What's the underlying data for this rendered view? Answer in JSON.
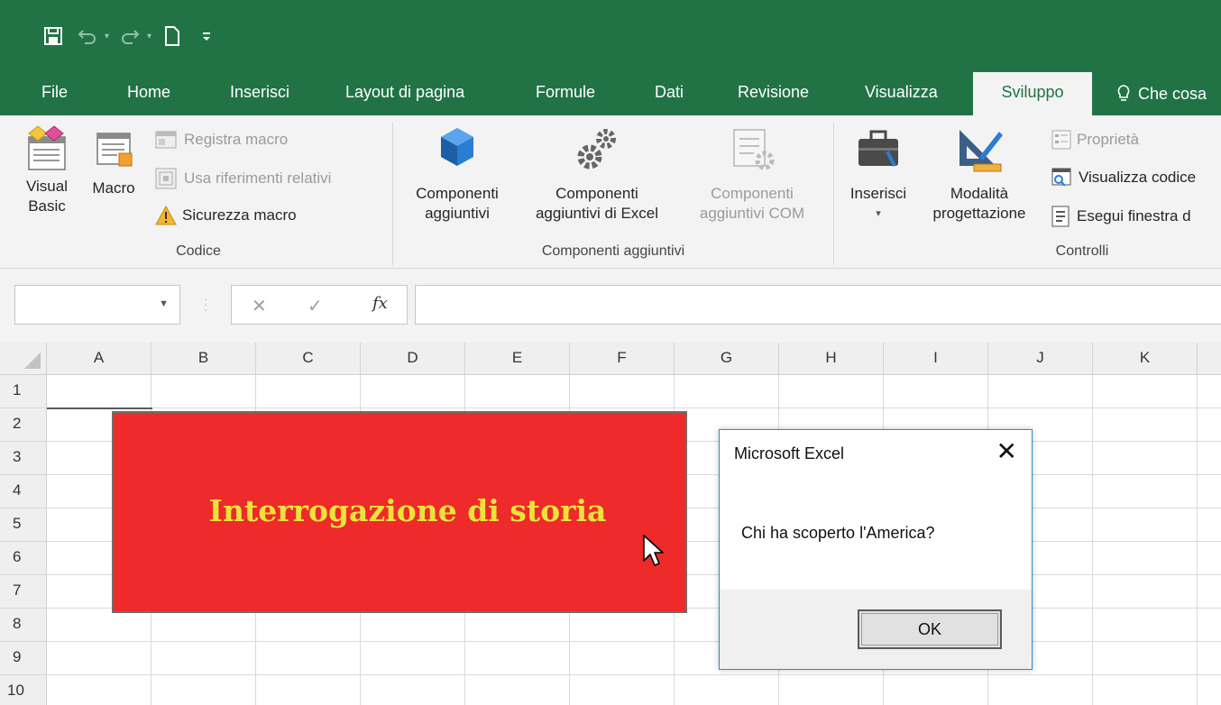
{
  "colors": {
    "brand": "#217346",
    "shape_fill": "#ee2a2a",
    "shape_text": "#ebe33a",
    "dialog_border": "#2d8bd0"
  },
  "quick_access": {
    "icons": [
      "save-icon",
      "undo-icon",
      "redo-icon",
      "new-document-icon",
      "customize-qat-icon"
    ]
  },
  "tabs": [
    "File",
    "Home",
    "Inserisci",
    "Layout di pagina",
    "Formule",
    "Dati",
    "Revisione",
    "Visualizza",
    "Sviluppo"
  ],
  "active_tab": "Sviluppo",
  "tell_me": "Che cosa",
  "ribbon": {
    "codice": {
      "label": "Codice",
      "visual_basic": [
        "Visual",
        "Basic"
      ],
      "macro": "Macro",
      "registra_macro": "Registra macro",
      "usa_riferimenti": "Usa riferimenti relativi",
      "sicurezza_macro": "Sicurezza macro"
    },
    "componenti": {
      "label": "Componenti aggiuntivi",
      "comp_agg": [
        "Componenti",
        "aggiuntivi"
      ],
      "comp_excel": [
        "Componenti",
        "aggiuntivi di Excel"
      ],
      "comp_com": [
        "Componenti",
        "aggiuntivi COM"
      ]
    },
    "controlli": {
      "label": "Controlli",
      "inserisci": "Inserisci",
      "modalita": [
        "Modalità",
        "progettazione"
      ],
      "proprieta": "Proprietà",
      "visualizza_codice": "Visualizza codice",
      "esegui_finestra": "Esegui finestra d"
    }
  },
  "formula_bar": {
    "name_box": "",
    "formula": ""
  },
  "grid": {
    "columns": [
      "A",
      "B",
      "C",
      "D",
      "E",
      "F",
      "G",
      "H",
      "I",
      "J",
      "K"
    ],
    "rows": [
      "1",
      "2",
      "3",
      "4",
      "5",
      "6",
      "7",
      "8",
      "9",
      "10"
    ]
  },
  "shape_button": {
    "text": "Interrogazione di storia"
  },
  "msgbox": {
    "title": "Microsoft Excel",
    "message": "Chi ha scoperto l'America?",
    "ok_label": "OK"
  }
}
